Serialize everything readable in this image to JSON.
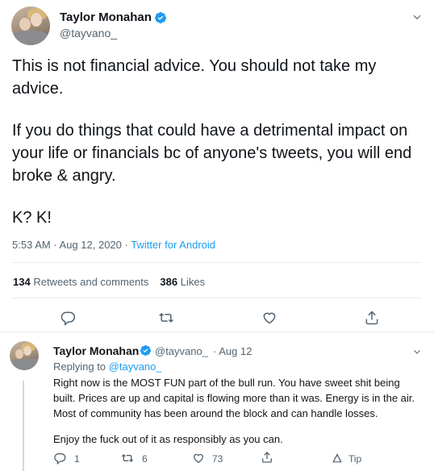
{
  "main_tweet": {
    "author_name": "Taylor Monahan",
    "author_handle": "@tayvano_",
    "text": [
      "This is not financial advice. You should not take my advice.",
      "If you do things that could have a detrimental impact on your life or financials bc of anyone's tweets, you will end broke & angry.",
      "K? K!"
    ],
    "timestamp": "5:53 AM · Aug 12, 2020 · ",
    "source": "Twitter for Android",
    "retweets_count": "134",
    "retweets_label": "Retweets and comments",
    "likes_count": "386",
    "likes_label": "Likes"
  },
  "reply_tweet": {
    "author_name": "Taylor Monahan",
    "author_handle": "@tayvano_",
    "date": "· Aug 12",
    "replying_to_label": "Replying to ",
    "replying_to_handle": "@tayvano_",
    "text": [
      "Right now is the MOST FUN part of the bull run. You have sweet shit being built. Prices are up and capital is flowing more than it was. Energy is in the air. Most of community has been around the block and can handle losses.",
      "Enjoy the fuck out of it as responsibly as you can."
    ],
    "reply_count": "1",
    "retweet_count": "6",
    "like_count": "73",
    "tip_label": "Tip"
  },
  "colors": {
    "accent": "#1d9bf0",
    "text_primary": "#0f1419",
    "text_secondary": "#536471",
    "divider": "#e6ecf0"
  },
  "icons": [
    "verified-badge-icon",
    "chevron-down-icon",
    "reply-icon",
    "retweet-icon",
    "like-icon",
    "share-icon",
    "tip-icon"
  ]
}
